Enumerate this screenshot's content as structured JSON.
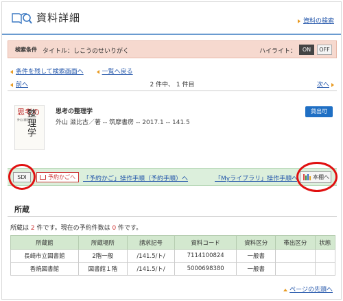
{
  "header": {
    "title": "資料詳細",
    "search_link": "資料の検索"
  },
  "condition": {
    "label": "検索条件",
    "text": "タイトル：しこうのせいりがく",
    "highlight_label": "ハイライト：",
    "on_label": "ON",
    "off_label": "OFF",
    "highlight_state": "ON"
  },
  "nav": {
    "keep_link": "条件を残して検索画面へ",
    "list_link": "一覧へ戻る"
  },
  "pager": {
    "prev": "前へ",
    "count": "2 件中、 1 件目",
    "next": "次へ"
  },
  "record": {
    "title": "思考の整理学",
    "meta": "外山 滋比古／著 -- 筑摩書房 -- 2017.1 -- 141.5",
    "availability": "貸出可",
    "cover": {
      "red": "思考の",
      "big": "整理学",
      "author": "外山 滋比古"
    }
  },
  "actions": {
    "sdi": "SDI",
    "cart": "予約かごへ",
    "cart_manual": "「予約かご」操作手順（予約手順）へ",
    "mylibrary_manual": "「Myライブラリ」操作手順へ",
    "shelf": "本棚へ"
  },
  "holdings": {
    "title": "所蔵",
    "summary_prefix": "所蔵は ",
    "count": "2",
    "summary_mid": " 件です。現在の予約件数は ",
    "reserved": "0",
    "summary_suffix": " 件です。",
    "columns": [
      "所蔵館",
      "所蔵場所",
      "請求記号",
      "資料コード",
      "資料区分",
      "帯出区分",
      "状態"
    ],
    "rows": [
      [
        "長崎市立図書館",
        "2階一般",
        "/141.5/ト/",
        "7114100824",
        "一般書",
        "",
        ""
      ],
      [
        "香焼図書館",
        "図書館１階",
        "/141.5/ト/",
        "5000698380",
        "一般書",
        "",
        ""
      ]
    ]
  },
  "footer": {
    "top_link": "ページの先頭へ"
  },
  "colors": {
    "accent_blue": "#1f6fc4",
    "link": "#2255aa",
    "highlight_circle": "#e01010",
    "condition_bg": "#f6d9cf",
    "table_header": "#d3e8cf"
  }
}
